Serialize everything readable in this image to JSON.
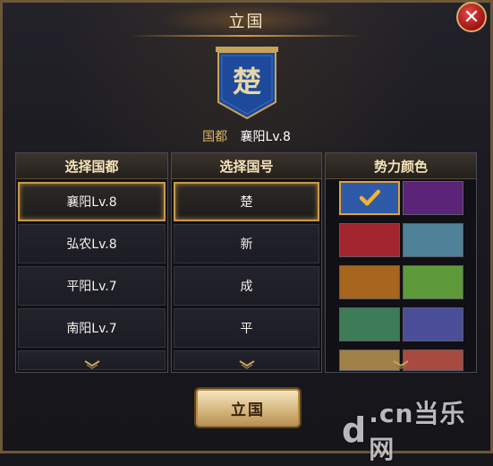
{
  "window": {
    "title": "立国",
    "close_glyph": "✕"
  },
  "banner": {
    "character": "楚",
    "color": "#1d4a9a"
  },
  "capital": {
    "label": "国都",
    "value": "襄阳Lv.8"
  },
  "columns": {
    "capital": {
      "header": "选择国都",
      "items": [
        "襄阳Lv.8",
        "弘农Lv.8",
        "平阳Lv.7",
        "南阳Lv.7"
      ],
      "selected": 0
    },
    "name": {
      "header": "选择国号",
      "items": [
        "楚",
        "新",
        "成",
        "平"
      ],
      "selected": 0
    },
    "color": {
      "header": "势力颜色",
      "swatches": [
        "#2f5aa8",
        "#5c2478",
        "#a3252e",
        "#4f8298",
        "#a7651e",
        "#5f9a3a",
        "#3c7c56",
        "#4a4e98",
        "#a08248",
        "#a84a40"
      ],
      "selected": 0
    }
  },
  "actions": {
    "confirm_label": "立国"
  },
  "watermark": {
    "d": "d",
    "rest": ".cn当乐网"
  },
  "colors": {
    "accent": "#c89a48",
    "panel_bg": "#101015",
    "text": "#f4f1ea",
    "header_text": "#f7e3b8"
  }
}
